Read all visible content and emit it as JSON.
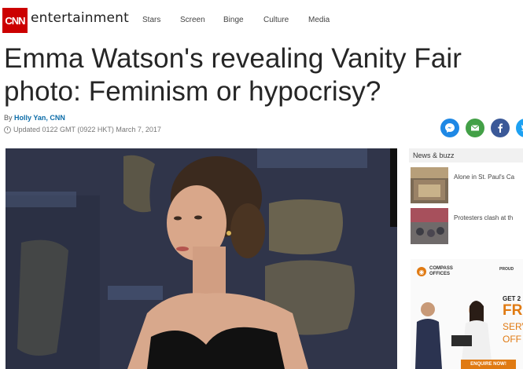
{
  "header": {
    "logo": "CNN",
    "section": "entertainment",
    "nav": [
      "Stars",
      "Screen",
      "Binge",
      "Culture",
      "Media"
    ]
  },
  "article": {
    "headline_line1": "Emma Watson's revealing Vanity Fair",
    "headline_line2": "photo: Feminism or hypocrisy?",
    "byline_prefix": "By",
    "author": "Holly Yan, CNN",
    "updated": "Updated 0122 GMT (0922 HKT) March 7, 2017"
  },
  "share": {
    "icons": [
      "messenger-icon",
      "email-icon",
      "facebook-icon",
      "twitter-icon"
    ]
  },
  "rail": {
    "title": "News & buzz",
    "items": [
      {
        "text": "Alone in St. Paul's Ca"
      },
      {
        "text": "Protesters clash at th"
      }
    ]
  },
  "ad": {
    "brand": "COMPASS OFFICES",
    "proud": "PROUD",
    "get": "GET 2",
    "free": "FR",
    "serv": "SERV",
    "off": "OFF",
    "enquire": "ENQUIRE NOW!"
  },
  "colors": {
    "brand": "#cc0000",
    "link": "#0c6ca8",
    "ad_accent": "#e07a12"
  }
}
